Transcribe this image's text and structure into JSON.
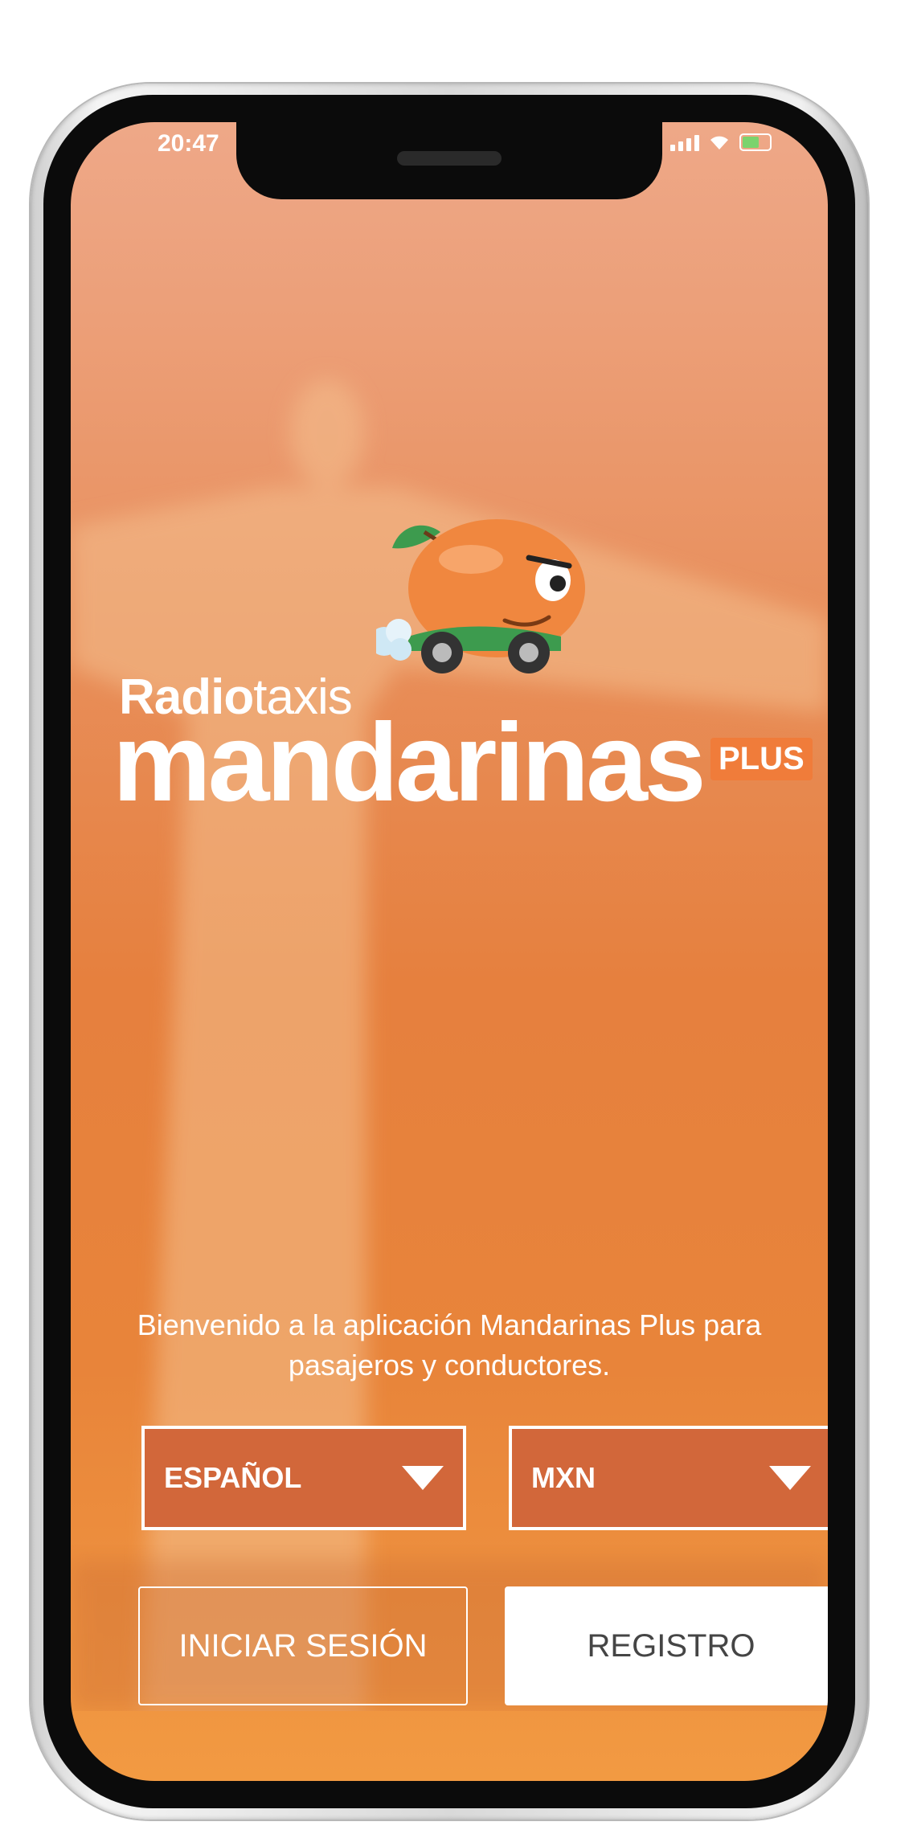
{
  "status_bar": {
    "time": "20:47"
  },
  "logo": {
    "radio_bold": "Radio",
    "radio_light": "taxis",
    "brand": "mandarinas",
    "plus": "PLUS"
  },
  "welcome_text": "Bienvenido a la aplicación Mandarinas Plus para pasajeros y conductores.",
  "language_select": {
    "value": "ESPAÑOL"
  },
  "currency_select": {
    "value": "MXN"
  },
  "buttons": {
    "login": "INICIAR SESIÓN",
    "register": "REGISTRO"
  },
  "colors": {
    "accent": "#e6803e",
    "select_bg": "#d2673a",
    "plus_badge": "#f07c3a"
  }
}
